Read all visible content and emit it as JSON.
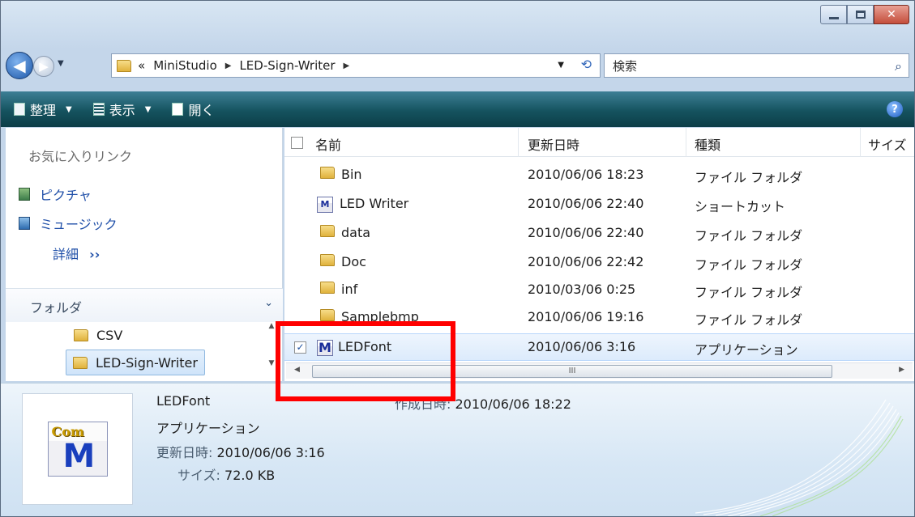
{
  "window": {
    "close_glyph": "✕"
  },
  "nav_buttons": {
    "back_glyph": "◀",
    "forward_glyph": "▶",
    "dropdown_glyph": "▼"
  },
  "address": {
    "overflow": "«",
    "crumbs": [
      "MiniStudio",
      "LED-Sign-Writer"
    ],
    "separator": "▶",
    "dropdown_glyph": "▼",
    "refresh_glyph": "⟲"
  },
  "search": {
    "placeholder": "検索",
    "icon": "search-icon",
    "glyph": "⌕"
  },
  "toolbar": {
    "organize": "整理",
    "views": "表示",
    "open": "開く",
    "dropdown_glyph": "▼",
    "help_glyph": "?",
    "color": "#15535f"
  },
  "nav": {
    "favorites_title": "お気に入りリンク",
    "favorites": [
      "ピクチャ",
      "ミュージック"
    ],
    "more": "詳細",
    "more_glyph": "››",
    "folders_title": "フォルダ",
    "folders_chevron": "⌄",
    "tree": [
      "CSV",
      "LED-Sign-Writer"
    ]
  },
  "list": {
    "columns": [
      "名前",
      "更新日時",
      "種類",
      "サイズ"
    ],
    "rows": [
      {
        "name": "Bin",
        "date": "2010/06/06 18:23",
        "type": "ファイル フォルダ",
        "icon": "folder"
      },
      {
        "name": "LED Writer",
        "date": "2010/06/06 22:40",
        "type": "ショートカット",
        "icon": "shortcut"
      },
      {
        "name": "data",
        "date": "2010/06/06 22:40",
        "type": "ファイル フォルダ",
        "icon": "folder"
      },
      {
        "name": "Doc",
        "date": "2010/06/06 22:42",
        "type": "ファイル フォルダ",
        "icon": "folder"
      },
      {
        "name": "inf",
        "date": "2010/03/06 0:25",
        "type": "ファイル フォルダ",
        "icon": "folder"
      },
      {
        "name": "Samplebmp",
        "date": "2010/06/06 19:16",
        "type": "ファイル フォルダ",
        "icon": "folder"
      },
      {
        "name": "LEDFont",
        "date": "2010/06/06 3:16",
        "type": "アプリケーション",
        "icon": "app",
        "selected": true
      }
    ],
    "check_glyph": "✓",
    "scroll_thumb": "III",
    "scroll_left": "◀",
    "scroll_right": "▶"
  },
  "details": {
    "name": "LEDFont",
    "type": "アプリケーション",
    "modified_label": "更新日時:",
    "modified": "2010/06/06 3:16",
    "size_label": "サイズ:",
    "size": "72.0 KB",
    "created_label": "作成日時:",
    "created": "2010/06/06 18:22",
    "icon_text": "Com",
    "icon_letter": "M"
  },
  "annotation": {
    "color": "#ff0000"
  }
}
